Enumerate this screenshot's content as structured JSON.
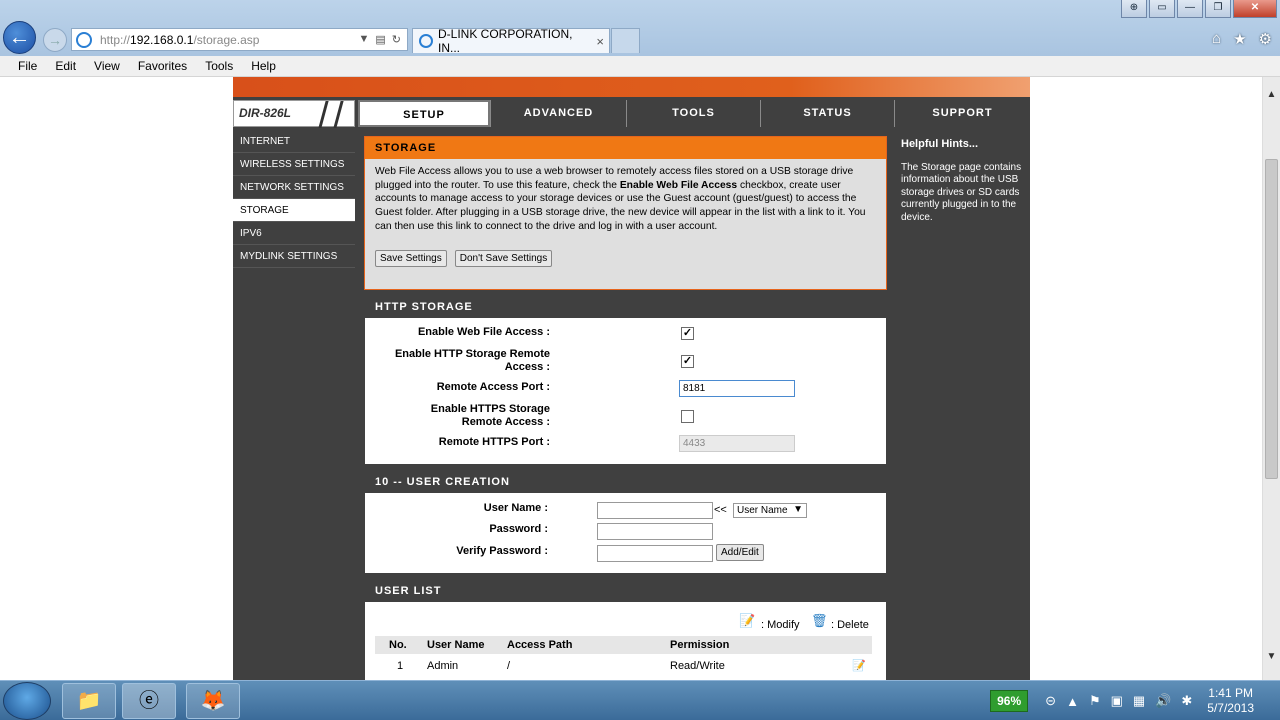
{
  "browser": {
    "url_prefix": "http://",
    "url_host": "192.168.0.1",
    "url_path": "/storage.asp",
    "tab_title": "D-LINK CORPORATION, IN...",
    "tab_close": "×",
    "win_controls": [
      "⊕",
      "▭",
      "—",
      "❐",
      "✕"
    ],
    "tools_icons": [
      "⌂",
      "★",
      "⚙"
    ]
  },
  "menubar": [
    "File",
    "Edit",
    "View",
    "Favorites",
    "Tools",
    "Help"
  ],
  "router": {
    "model": "DIR-826L",
    "top_tabs": [
      "SETUP",
      "ADVANCED",
      "TOOLS",
      "STATUS",
      "SUPPORT"
    ],
    "sidebar": [
      "INTERNET",
      "WIRELESS SETTINGS",
      "NETWORK SETTINGS",
      "STORAGE",
      "IPV6",
      "MYDLINK SETTINGS"
    ],
    "storage": {
      "title": "STORAGE",
      "desc_1": "Web File Access allows you to use a web browser to remotely access files stored on a USB storage drive plugged into the router. To use this feature, check the ",
      "desc_bold": "Enable Web File Access",
      "desc_2": " checkbox, create user accounts to manage access to your storage devices or use the Guest account (guest/guest) to access the Guest folder. After plugging in a USB storage drive, the new device will appear in the list with a link to it. You can then use this link to connect to the drive and log in with a user account.",
      "save": "Save Settings",
      "dont_save": "Don't Save Settings"
    },
    "http_storage": {
      "title": "HTTP STORAGE",
      "enable_web": "Enable Web File Access :",
      "enable_http_remote_1": "Enable HTTP Storage Remote",
      "enable_http_remote_2": "Access :",
      "remote_port": "Remote Access Port :",
      "remote_port_value": "8181",
      "enable_https_1": "Enable HTTPS Storage",
      "enable_https_2": "Remote Access :",
      "https_port": "Remote HTTPS Port :",
      "https_port_value": "4433",
      "check": "✓"
    },
    "user_creation": {
      "title": "10 -- USER CREATION",
      "username": "User Name :",
      "password": "Password :",
      "verify": "Verify Password :",
      "arrow": "<<",
      "select": "User Name",
      "add_edit": "Add/Edit"
    },
    "user_list": {
      "title": "USER LIST",
      "modify": ": Modify",
      "delete": ": Delete",
      "columns": [
        "No.",
        "User Name",
        "Access Path",
        "Permission"
      ],
      "rows": [
        [
          "1",
          "Admin",
          "/",
          "Read/Write"
        ]
      ]
    },
    "hints": {
      "title": "Helpful Hints...",
      "text": "The Storage page contains information about the USB storage drives or SD cards currently plugged in to the device."
    }
  },
  "taskbar": {
    "battery": "96%",
    "time": "1:41 PM",
    "date": "5/7/2013"
  }
}
